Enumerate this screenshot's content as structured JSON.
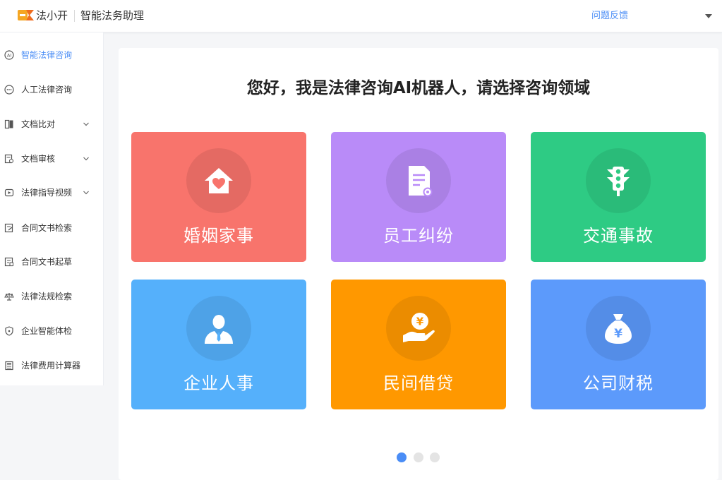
{
  "header": {
    "logo_text": "法小开",
    "app_title": "智能法务助理",
    "feedback_label": "问题反馈",
    "dropdown_icon": "caret-down-icon",
    "brand_color": "#f5a623"
  },
  "sidebar": {
    "items": [
      {
        "label": "智能法律咨询",
        "icon": "ai-icon",
        "active": true
      },
      {
        "label": "人工法律咨询",
        "icon": "chat-bubble-icon"
      },
      {
        "label": "文档比对",
        "icon": "compare-document-icon",
        "expandable": true
      },
      {
        "label": "文档审核",
        "icon": "review-document-icon",
        "expandable": true
      },
      {
        "label": "法律指导视频",
        "icon": "video-play-icon",
        "expandable": true
      },
      {
        "label": "合同文书检索",
        "icon": "search-document-icon"
      },
      {
        "label": "合同文书起草",
        "icon": "edit-document-icon"
      },
      {
        "label": "法律法规检索",
        "icon": "scales-icon"
      },
      {
        "label": "企业智能体检",
        "icon": "shield-icon"
      },
      {
        "label": "法律费用计算器",
        "icon": "calculator-icon"
      }
    ],
    "accent_color": "#4a8df6"
  },
  "main": {
    "heading": "您好，我是法律咨询AI机器人，请选择咨询领域",
    "tiles": [
      {
        "label": "婚姻家事",
        "icon": "house-heart-icon",
        "color": "#f8746c"
      },
      {
        "label": "员工纠纷",
        "icon": "document-badge-icon",
        "color": "#b98bf8"
      },
      {
        "label": "交通事故",
        "icon": "traffic-light-icon",
        "color": "#2ecb84"
      },
      {
        "label": "企业人事",
        "icon": "person-icon",
        "color": "#55b0fb"
      },
      {
        "label": "民间借贷",
        "icon": "hand-coin-icon",
        "color": "#ff9800"
      },
      {
        "label": "公司财税",
        "icon": "money-bag-icon",
        "color": "#5c9afb"
      }
    ],
    "pagination": {
      "pages": 3,
      "current": 1
    }
  }
}
